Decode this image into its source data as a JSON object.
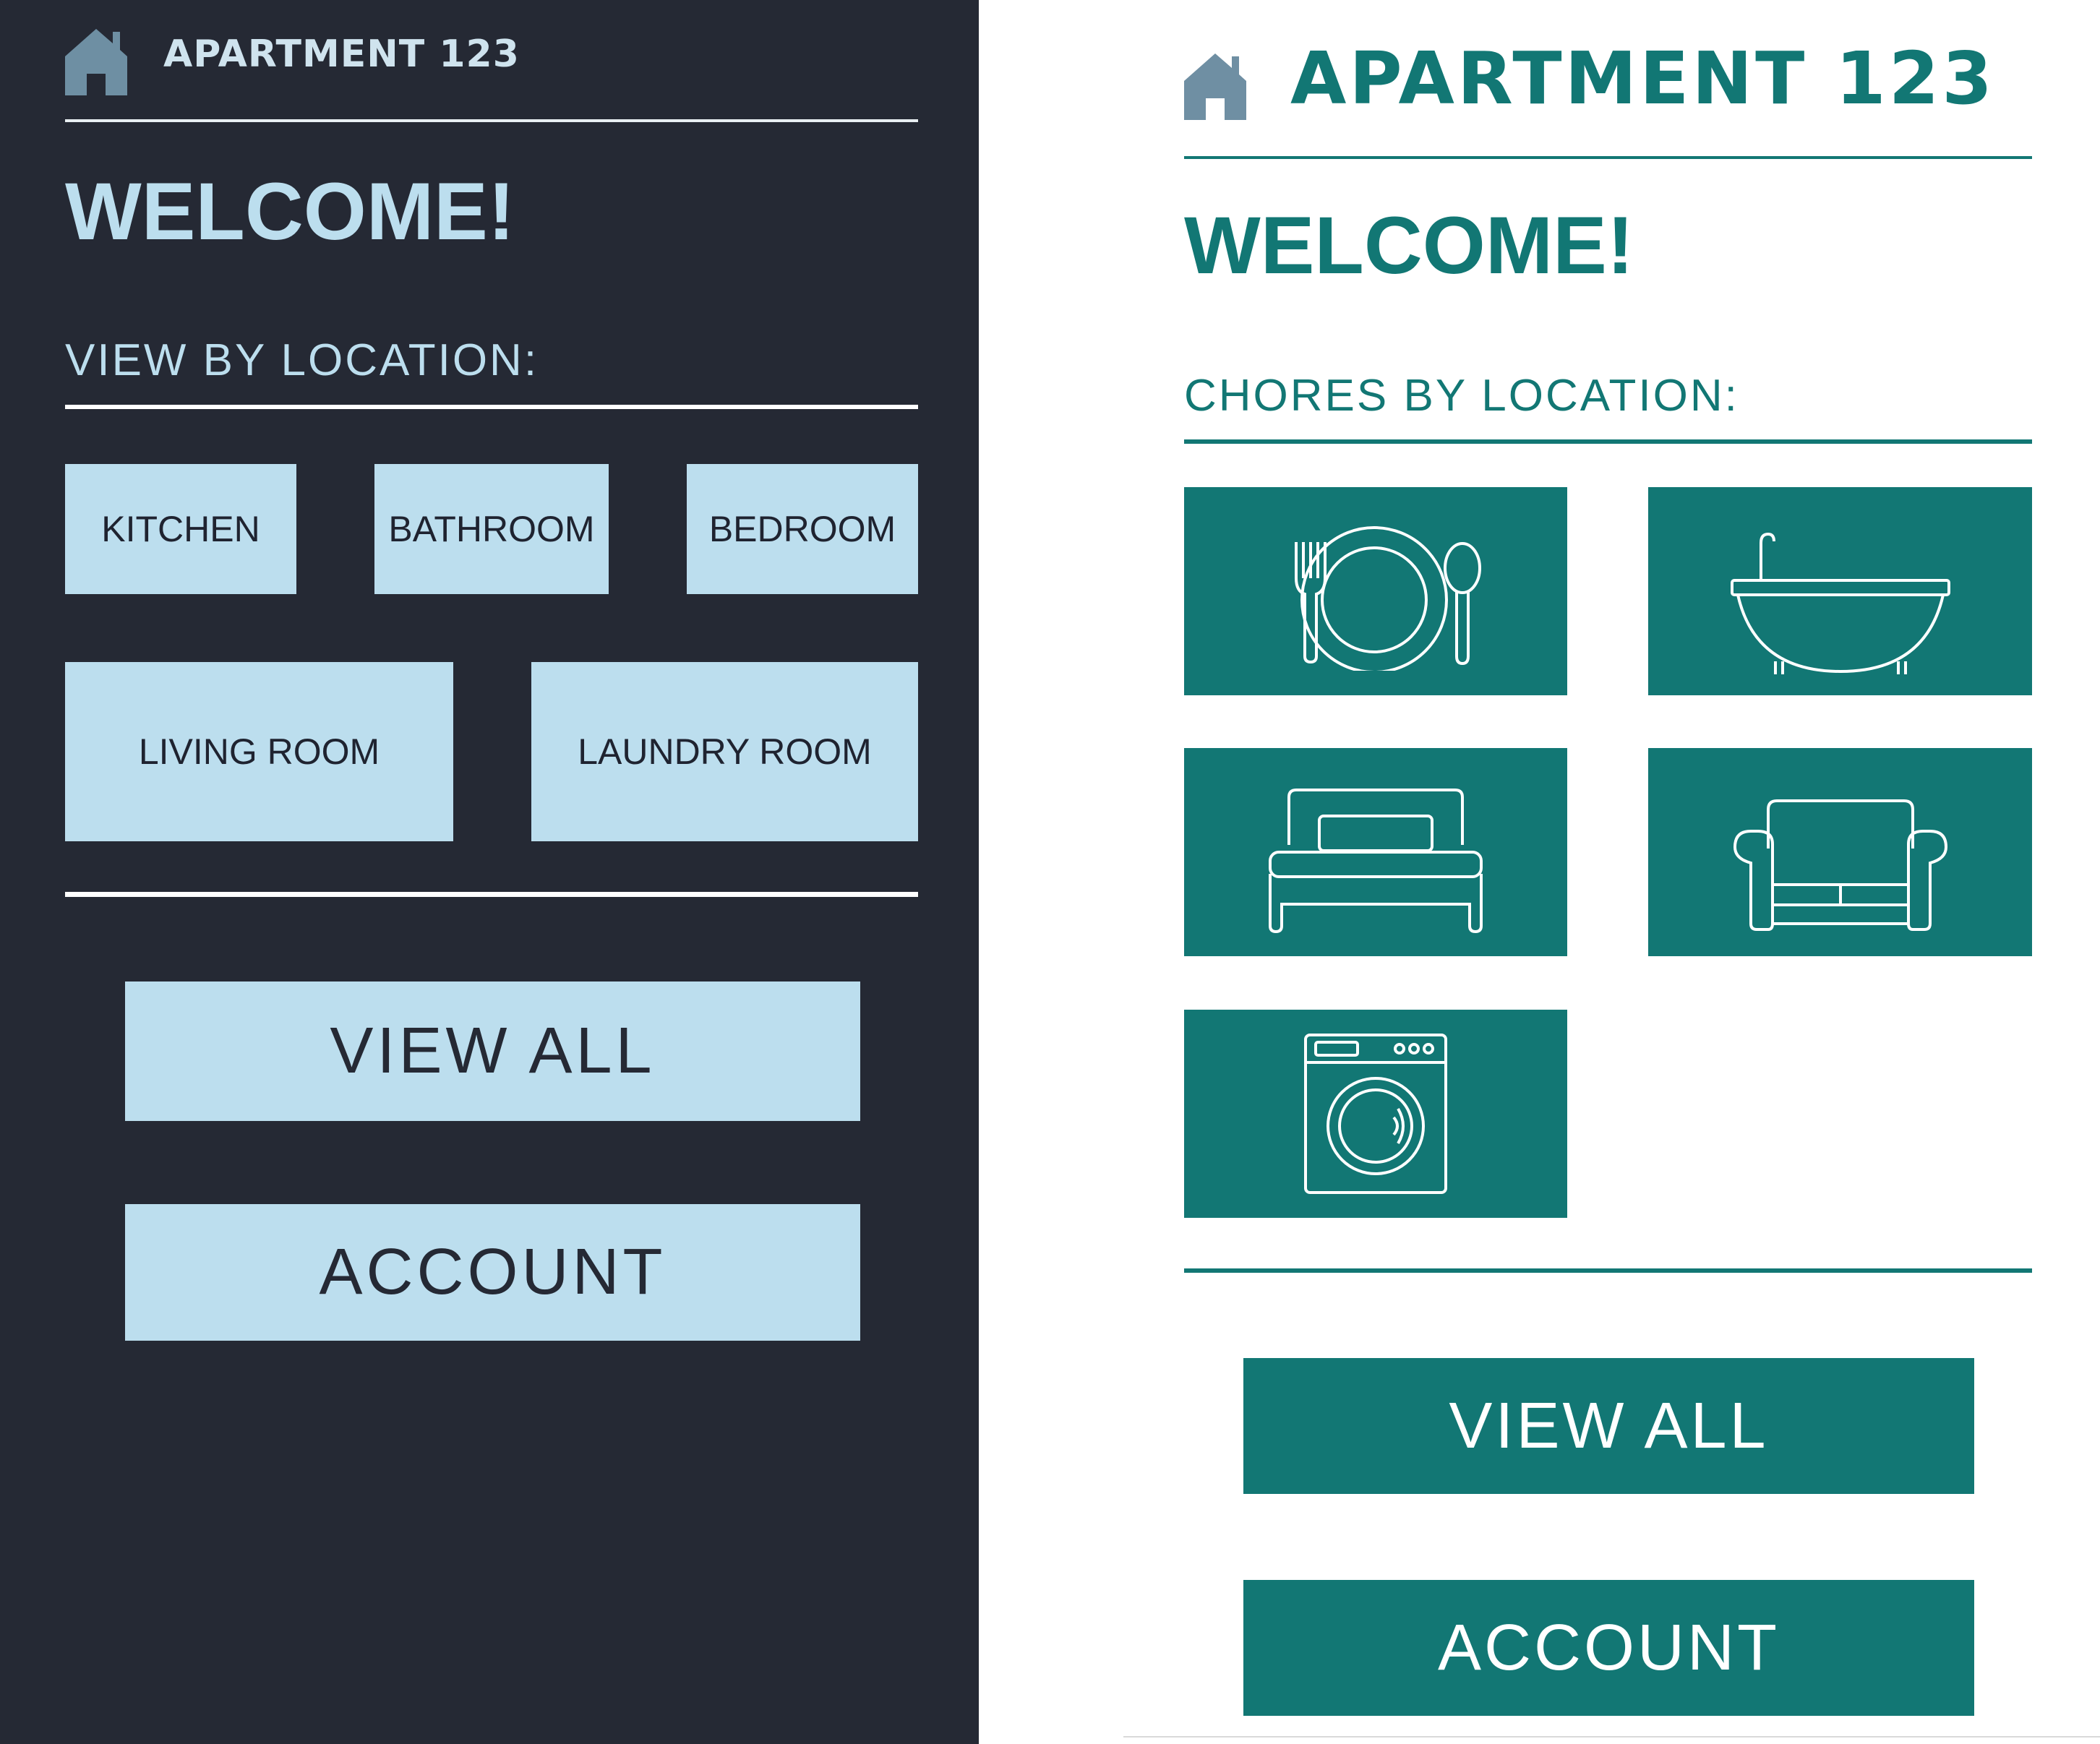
{
  "left_screen": {
    "header": {
      "title": "APARTMENT 123",
      "icon": "house-icon"
    },
    "welcome": "WELCOME!",
    "section_title": "VIEW BY LOCATION:",
    "locations": [
      "KITCHEN",
      "BATHROOM",
      "BEDROOM",
      "LIVING ROOM",
      "LAUNDRY ROOM"
    ],
    "buttons": {
      "view_all": "VIEW ALL",
      "account": "ACCOUNT"
    },
    "colors": {
      "background": "#252934",
      "accent": "#bcdeee",
      "text": "#ffffff"
    }
  },
  "right_screen": {
    "header": {
      "title": "APARTMENT 123",
      "icon": "house-icon"
    },
    "welcome": "WELCOME!",
    "section_title": "CHORES BY LOCATION:",
    "tiles": [
      {
        "icon": "place-setting-icon"
      },
      {
        "icon": "bathtub-icon"
      },
      {
        "icon": "bed-icon"
      },
      {
        "icon": "armchair-icon"
      },
      {
        "icon": "washing-machine-icon"
      }
    ],
    "buttons": {
      "view_all": "VIEW ALL",
      "account": "ACCOUNT"
    },
    "colors": {
      "background": "#ffffff",
      "accent": "#127774",
      "icon": "#6f8fa3"
    }
  }
}
